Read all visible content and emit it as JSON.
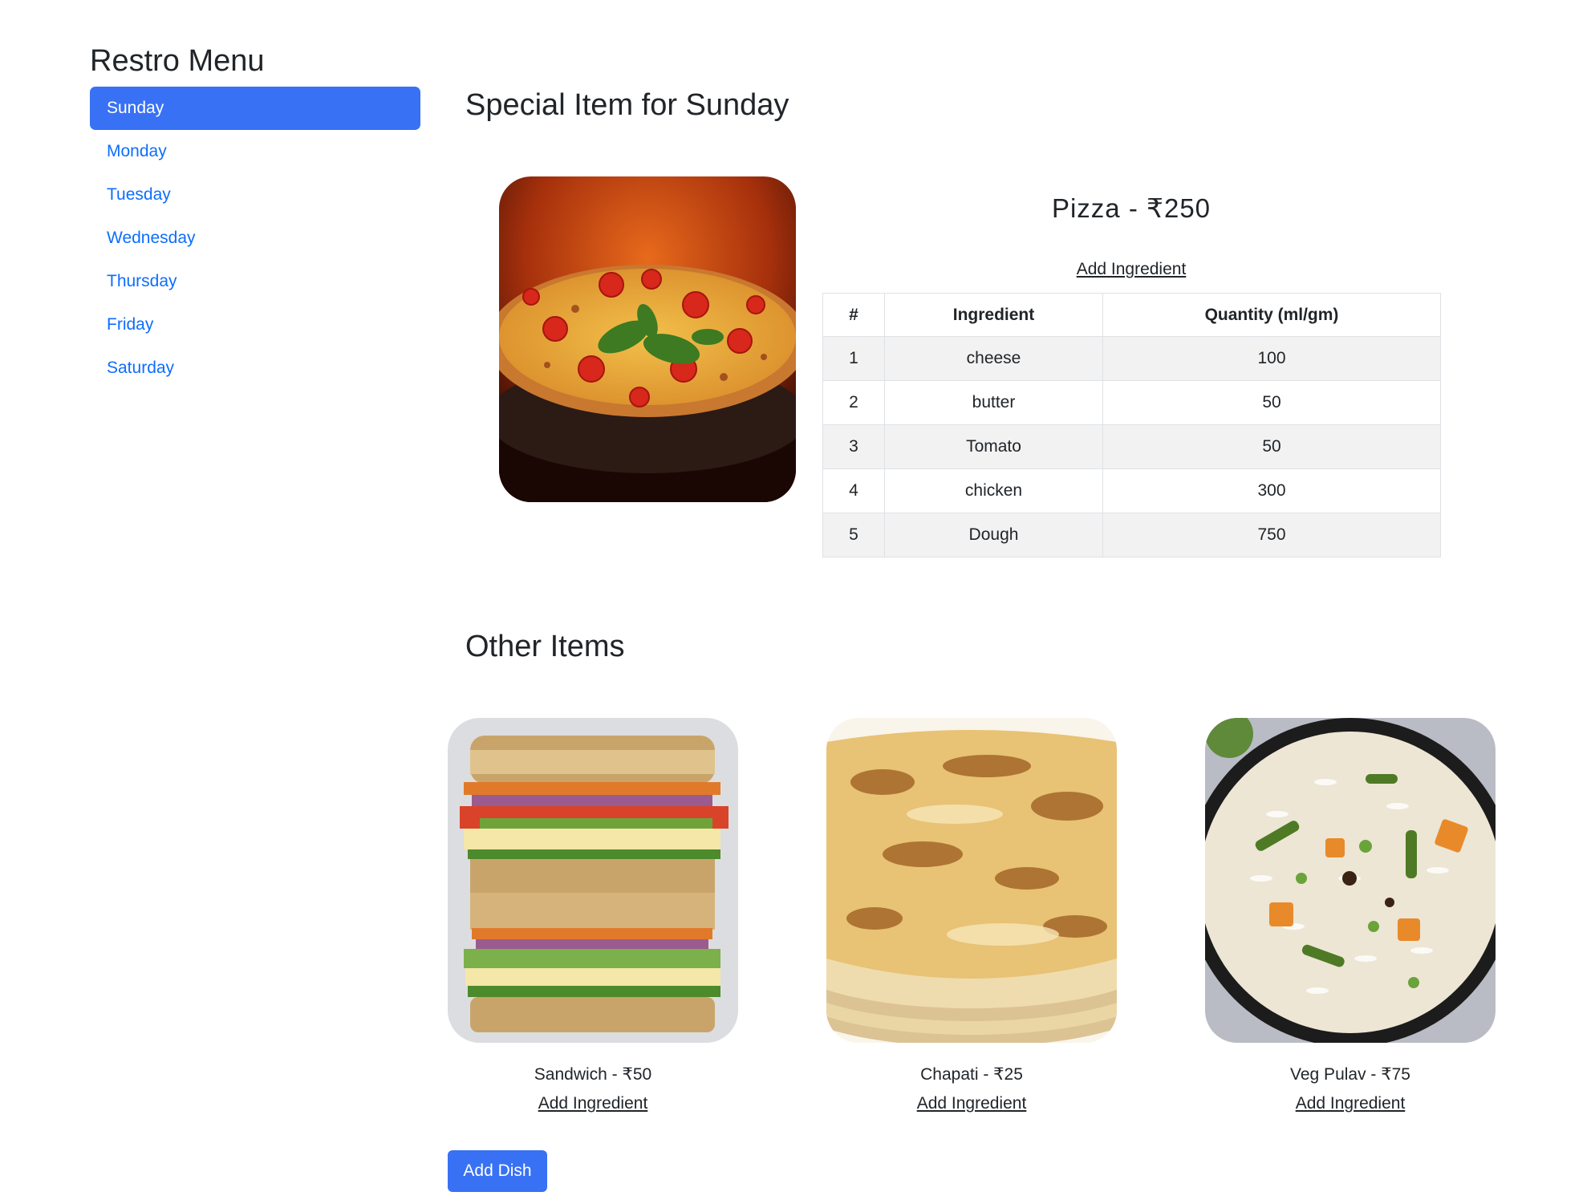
{
  "sidebar": {
    "title": "Restro Menu",
    "days": [
      "Sunday",
      "Monday",
      "Tuesday",
      "Wednesday",
      "Thursday",
      "Friday",
      "Saturday"
    ],
    "active_day": "Sunday"
  },
  "special": {
    "heading": "Special Item for Sunday",
    "dish_label": "Pizza - ₹250",
    "add_ingredient_label": "Add Ingredient",
    "table": {
      "headers": [
        "#",
        "Ingredient",
        "Quantity (ml/gm)"
      ],
      "rows": [
        [
          "1",
          "cheese",
          "100"
        ],
        [
          "2",
          "butter",
          "50"
        ],
        [
          "3",
          "Tomato",
          "50"
        ],
        [
          "4",
          "chicken",
          "300"
        ],
        [
          "5",
          "Dough",
          "750"
        ]
      ]
    }
  },
  "other": {
    "heading": "Other Items",
    "items": [
      {
        "label": "Sandwich - ₹50",
        "add_ingredient_label": "Add Ingredient"
      },
      {
        "label": "Chapati - ₹25",
        "add_ingredient_label": "Add Ingredient"
      },
      {
        "label": "Veg Pulav - ₹75",
        "add_ingredient_label": "Add Ingredient"
      }
    ]
  },
  "add_dish_label": "Add Dish",
  "colors": {
    "accent": "#3871f4",
    "link": "#0d6efd",
    "stripe": "#f2f2f2"
  }
}
